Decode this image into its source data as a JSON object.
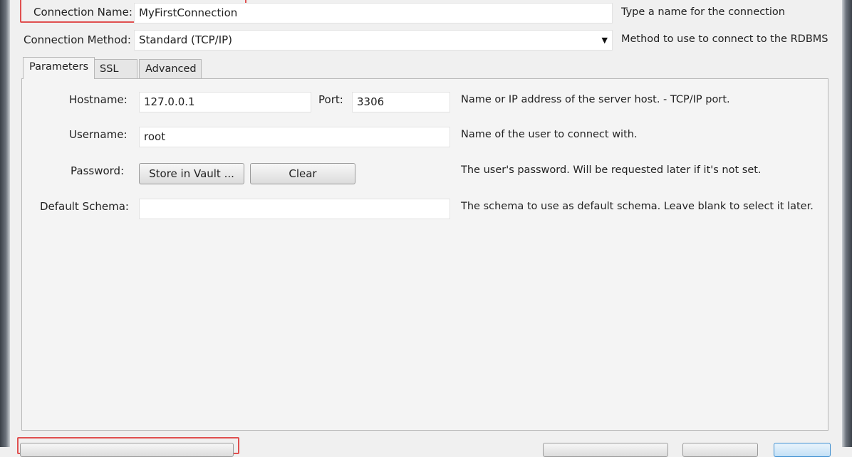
{
  "connection": {
    "name_label": "Connection Name:",
    "name_value": "MyFirstConnection",
    "name_hint": "Type a name for the connection",
    "method_label": "Connection Method:",
    "method_value": "Standard (TCP/IP)",
    "method_hint": "Method to use to connect to the RDBMS"
  },
  "tabs": [
    {
      "label": "Parameters",
      "active": true
    },
    {
      "label": "SSL",
      "active": false
    },
    {
      "label": "Advanced",
      "active": false
    }
  ],
  "parameters": {
    "hostname_label": "Hostname:",
    "hostname_value": "127.0.0.1",
    "port_label": "Port:",
    "port_value": "3306",
    "hostname_hint": "Name or IP address of the server host. - TCP/IP port.",
    "username_label": "Username:",
    "username_value": "root",
    "username_hint": "Name of the user to connect with.",
    "password_label": "Password:",
    "store_vault_label": "Store in Vault ...",
    "clear_label": "Clear",
    "password_hint": "The user's password. Will be requested later if it's not set.",
    "schema_label": "Default Schema:",
    "schema_value": "",
    "schema_hint": "The schema to use as default schema. Leave blank to select it later."
  },
  "colors": {
    "highlight": "#e05050",
    "window_bg": "#f0f0f0",
    "primary_button_border": "#3f8fd0"
  }
}
